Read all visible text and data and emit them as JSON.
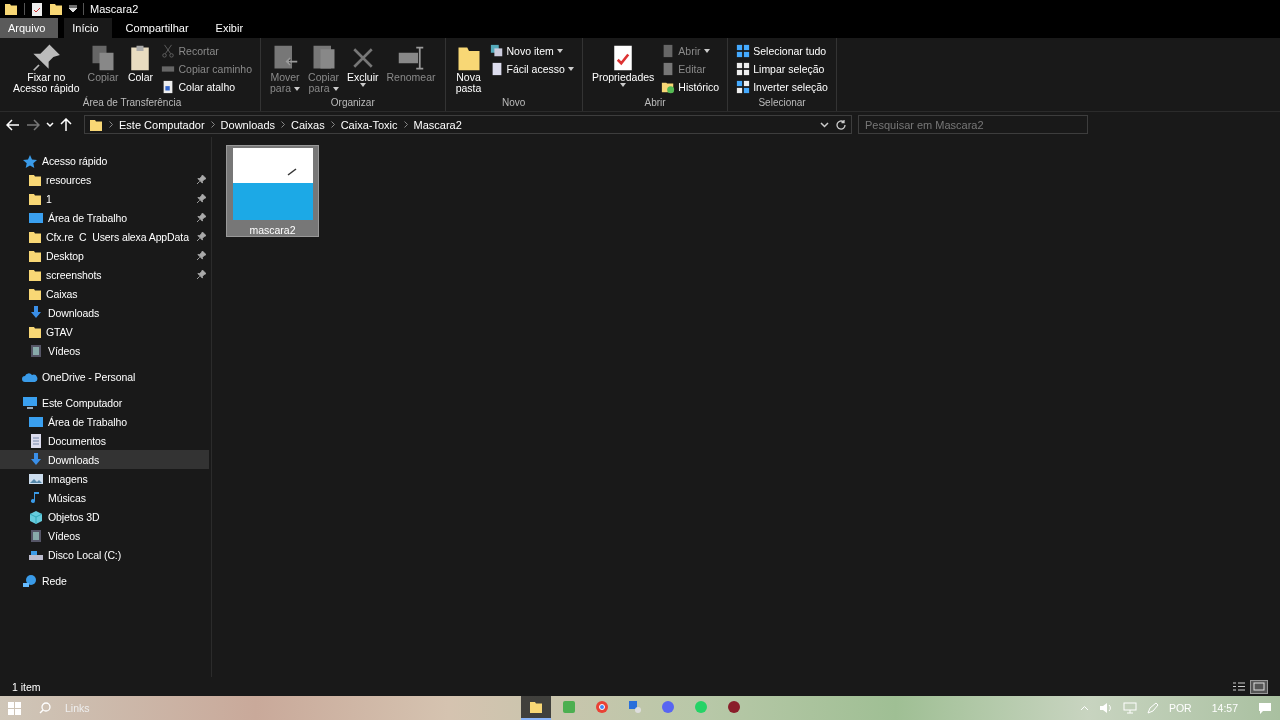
{
  "window": {
    "title": "Mascara2"
  },
  "ribbon_tabs": [
    {
      "label": "Arquivo",
      "kind": "file",
      "selected": false
    },
    {
      "label": "Início",
      "kind": "tab",
      "selected": true
    },
    {
      "label": "Compartilhar",
      "kind": "tab",
      "selected": false
    },
    {
      "label": "Exibir",
      "kind": "tab",
      "selected": false
    }
  ],
  "ribbon_groups": [
    {
      "title": "Área de Transferência",
      "buttons": [
        {
          "kind": "large",
          "lines": [
            "Fixar no",
            "Acesso rápido"
          ],
          "disabled": false,
          "dropdown": false
        },
        {
          "kind": "large",
          "lines": [
            "Copiar"
          ],
          "disabled": true,
          "dropdown": false
        },
        {
          "kind": "large",
          "lines": [
            "Colar"
          ],
          "disabled": false,
          "dropdown": false
        },
        {
          "kind": "small",
          "lines": [
            "Recortar"
          ],
          "disabled": true,
          "dropdown": false
        },
        {
          "kind": "small",
          "lines": [
            "Copiar caminho"
          ],
          "disabled": true,
          "dropdown": false
        },
        {
          "kind": "small",
          "lines": [
            "Colar atalho"
          ],
          "disabled": false,
          "dropdown": false
        }
      ]
    },
    {
      "title": "Organizar",
      "buttons": [
        {
          "kind": "large",
          "lines": [
            "Mover",
            "para"
          ],
          "disabled": true,
          "dropdown": true
        },
        {
          "kind": "large",
          "lines": [
            "Copiar",
            "para"
          ],
          "disabled": true,
          "dropdown": true
        },
        {
          "kind": "large",
          "lines": [
            "Excluir"
          ],
          "disabled": false,
          "dropdown": true
        },
        {
          "kind": "large",
          "lines": [
            "Renomear"
          ],
          "disabled": true,
          "dropdown": false
        }
      ]
    },
    {
      "title": "Novo",
      "buttons": [
        {
          "kind": "large",
          "lines": [
            "Nova",
            "pasta"
          ],
          "disabled": false,
          "dropdown": false
        },
        {
          "kind": "small",
          "lines": [
            "Novo item"
          ],
          "disabled": false,
          "dropdown": true
        },
        {
          "kind": "small",
          "lines": [
            "Fácil acesso"
          ],
          "disabled": false,
          "dropdown": true
        }
      ]
    },
    {
      "title": "Abrir",
      "buttons": [
        {
          "kind": "large",
          "lines": [
            "Propriedades"
          ],
          "disabled": false,
          "dropdown": true
        },
        {
          "kind": "small",
          "lines": [
            "Abrir"
          ],
          "disabled": true,
          "dropdown": true
        },
        {
          "kind": "small",
          "lines": [
            "Editar"
          ],
          "disabled": true,
          "dropdown": false
        },
        {
          "kind": "small",
          "lines": [
            "Histórico"
          ],
          "disabled": false,
          "dropdown": false
        }
      ]
    },
    {
      "title": "Selecionar",
      "buttons": [
        {
          "kind": "small",
          "lines": [
            "Selecionar tudo"
          ],
          "disabled": false,
          "dropdown": false
        },
        {
          "kind": "small",
          "lines": [
            "Limpar seleção"
          ],
          "disabled": false,
          "dropdown": false
        },
        {
          "kind": "small",
          "lines": [
            "Inverter seleção"
          ],
          "disabled": false,
          "dropdown": false
        }
      ]
    }
  ],
  "address": {
    "crumbs": [
      "Este Computador",
      "Downloads",
      "Caixas",
      "Caixa-Toxic",
      "Mascara2"
    ]
  },
  "search": {
    "placeholder": "Pesquisar em Mascara2"
  },
  "sidebar": {
    "items": [
      {
        "label": "Acesso rápido",
        "kind": "star",
        "selected": false,
        "children": [
          {
            "label": "resources",
            "kind": "folder",
            "pinned": true,
            "selected": false
          },
          {
            "label": "1",
            "kind": "folder",
            "pinned": true,
            "selected": false
          },
          {
            "label": "Área de Trabalho",
            "kind": "desktop",
            "pinned": true,
            "selected": false
          },
          {
            "label": "Cfx.re  C  Users alexa AppData",
            "kind": "folder",
            "pinned": true,
            "selected": false
          },
          {
            "label": "Desktop",
            "kind": "folder",
            "pinned": true,
            "selected": false
          },
          {
            "label": "screenshots",
            "kind": "folder",
            "pinned": true,
            "selected": false
          },
          {
            "label": "Caixas",
            "kind": "folder",
            "pinned": false,
            "selected": false
          },
          {
            "label": "Downloads",
            "kind": "download",
            "pinned": false,
            "selected": false
          },
          {
            "label": "GTAV",
            "kind": "folder",
            "pinned": false,
            "selected": false
          },
          {
            "label": "Vídeos",
            "kind": "video",
            "pinned": false,
            "selected": false
          }
        ]
      },
      {
        "label": "OneDrive - Personal",
        "kind": "cloud",
        "selected": false
      },
      {
        "label": "Este Computador",
        "kind": "computer",
        "selected": false,
        "children": [
          {
            "label": "Área de Trabalho",
            "kind": "desktop",
            "pinned": false,
            "selected": false
          },
          {
            "label": "Documentos",
            "kind": "document",
            "pinned": false,
            "selected": false
          },
          {
            "label": "Downloads",
            "kind": "download",
            "pinned": false,
            "selected": true
          },
          {
            "label": "Imagens",
            "kind": "image",
            "pinned": false,
            "selected": false
          },
          {
            "label": "Músicas",
            "kind": "music",
            "pinned": false,
            "selected": false
          },
          {
            "label": "Objetos 3D",
            "kind": "cube",
            "pinned": false,
            "selected": false
          },
          {
            "label": "Vídeos",
            "kind": "video",
            "pinned": false,
            "selected": false
          },
          {
            "label": "Disco Local (C:)",
            "kind": "drive",
            "pinned": false,
            "selected": false
          }
        ]
      },
      {
        "label": "Rede",
        "kind": "network",
        "selected": false
      }
    ]
  },
  "files": [
    {
      "name": "mascara2",
      "selected": true
    }
  ],
  "status_bar": {
    "count": "1 item",
    "views": [
      {
        "kind": "details",
        "selected": false
      },
      {
        "kind": "large",
        "selected": true
      }
    ]
  },
  "taskbar": {
    "search_placeholder": "Links",
    "apps": [
      {
        "kind": "explorer",
        "selected": true
      },
      {
        "kind": "green",
        "selected": false
      },
      {
        "kind": "chrome",
        "selected": false
      },
      {
        "kind": "tool",
        "selected": false
      },
      {
        "kind": "chat",
        "selected": false
      },
      {
        "kind": "phone",
        "selected": false
      },
      {
        "kind": "game",
        "selected": false
      }
    ],
    "language": "POR",
    "time": "14:57"
  }
}
